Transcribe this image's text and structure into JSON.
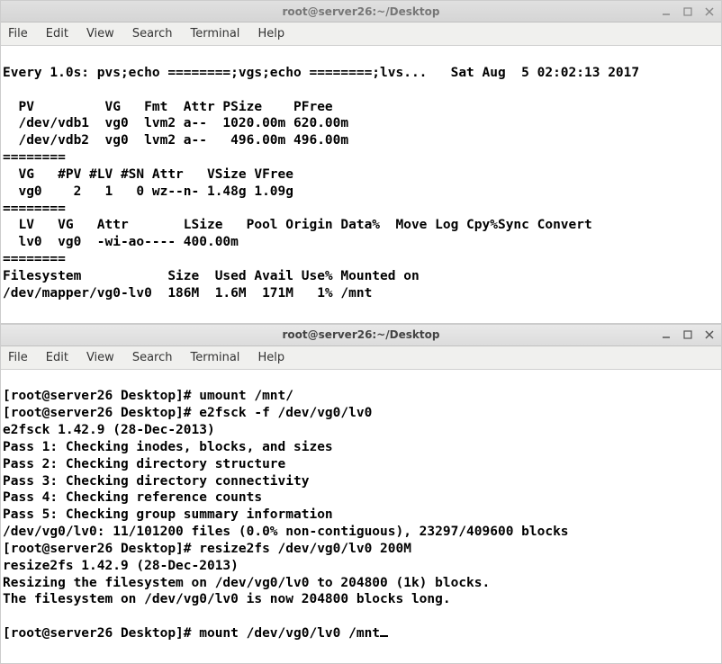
{
  "win1": {
    "title": "root@server26:~/Desktop",
    "menu": {
      "file": "File",
      "edit": "Edit",
      "view": "View",
      "search": "Search",
      "terminal": "Terminal",
      "help": "Help"
    },
    "lines": [
      "Every 1.0s: pvs;echo ========;vgs;echo ========;lvs...   Sat Aug  5 02:02:13 2017",
      "",
      "  PV         VG   Fmt  Attr PSize    PFree",
      "  /dev/vdb1  vg0  lvm2 a--  1020.00m 620.00m",
      "  /dev/vdb2  vg0  lvm2 a--   496.00m 496.00m",
      "========",
      "  VG   #PV #LV #SN Attr   VSize VFree",
      "  vg0    2   1   0 wz--n- 1.48g 1.09g",
      "========",
      "  LV   VG   Attr       LSize   Pool Origin Data%  Move Log Cpy%Sync Convert",
      "  lv0  vg0  -wi-ao---- 400.00m",
      "========",
      "Filesystem           Size  Used Avail Use% Mounted on",
      "/dev/mapper/vg0-lv0  186M  1.6M  171M   1% /mnt"
    ]
  },
  "win2": {
    "title": "root@server26:~/Desktop",
    "menu": {
      "file": "File",
      "edit": "Edit",
      "view": "View",
      "search": "Search",
      "terminal": "Terminal",
      "help": "Help"
    },
    "lines": [
      "[root@server26 Desktop]# umount /mnt/",
      "[root@server26 Desktop]# e2fsck -f /dev/vg0/lv0",
      "e2fsck 1.42.9 (28-Dec-2013)",
      "Pass 1: Checking inodes, blocks, and sizes",
      "Pass 2: Checking directory structure",
      "Pass 3: Checking directory connectivity",
      "Pass 4: Checking reference counts",
      "Pass 5: Checking group summary information",
      "/dev/vg0/lv0: 11/101200 files (0.0% non-contiguous), 23297/409600 blocks",
      "[root@server26 Desktop]# resize2fs /dev/vg0/lv0 200M",
      "resize2fs 1.42.9 (28-Dec-2013)",
      "Resizing the filesystem on /dev/vg0/lv0 to 204800 (1k) blocks.",
      "The filesystem on /dev/vg0/lv0 is now 204800 blocks long.",
      "",
      "[root@server26 Desktop]# mount /dev/vg0/lv0 /mnt"
    ]
  }
}
